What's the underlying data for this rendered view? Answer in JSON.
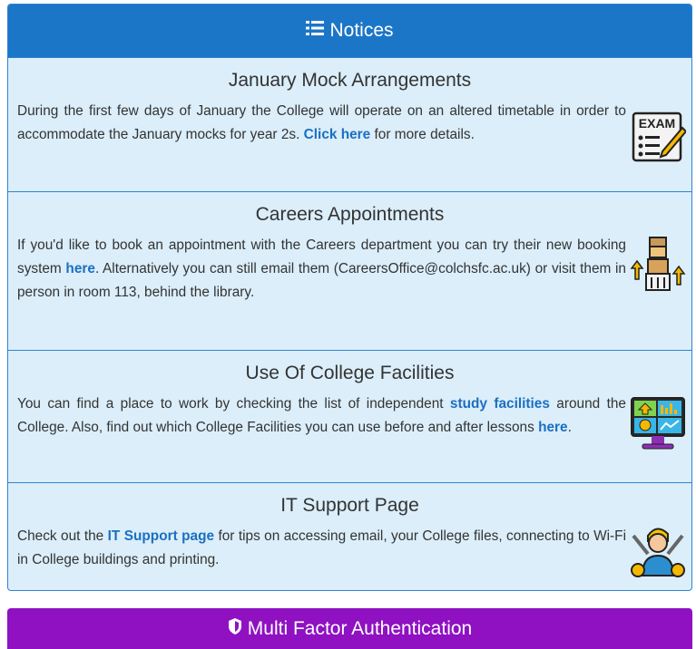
{
  "notices_panel": {
    "title": "Notices",
    "title_icon": "list-icon",
    "items": [
      {
        "heading": "January Mock Arrangements",
        "text_before": "During the first few days of January the College will operate on an altered timetable in order to accommodate the January mocks for year 2s. ",
        "link1": "Click here",
        "text_after": " for more details.",
        "icon": "exam-icon",
        "icon_text": "EXAM"
      },
      {
        "heading": "Careers Appointments",
        "text_before": "If you'd like to book an appointment with the Careers department you can try their new booking system ",
        "link1": "here",
        "text_after": ".  Alternatively you can still email them (CareersOffice@colchsfc.ac.uk) or visit them in person in room 113, behind the library.",
        "icon": "career-ladder-icon"
      },
      {
        "heading": "Use Of College Facilities",
        "text_before": "You can find a place to work by checking the list of independent ",
        "link1": "study facilities",
        "text_middle": " around the College. Also, find out which College Facilities you can use before and after lessons ",
        "link2": "here",
        "text_after": ".",
        "icon": "monitor-dashboard-icon"
      },
      {
        "heading": "IT Support Page",
        "text_before": "Check out the ",
        "link1": "IT Support page",
        "text_after": " for tips on accessing email, your College files, connecting to Wi-Fi in College buildings and printing.",
        "icon": "tech-support-icon"
      }
    ]
  },
  "mfa_panel": {
    "title": "Multi Factor Authentication",
    "title_icon": "shield-icon"
  },
  "colors": {
    "notices_header": "#1c76c8",
    "notices_body": "#dbeefa",
    "link": "#1c6fc0",
    "mfa_header": "#8f11c2"
  }
}
